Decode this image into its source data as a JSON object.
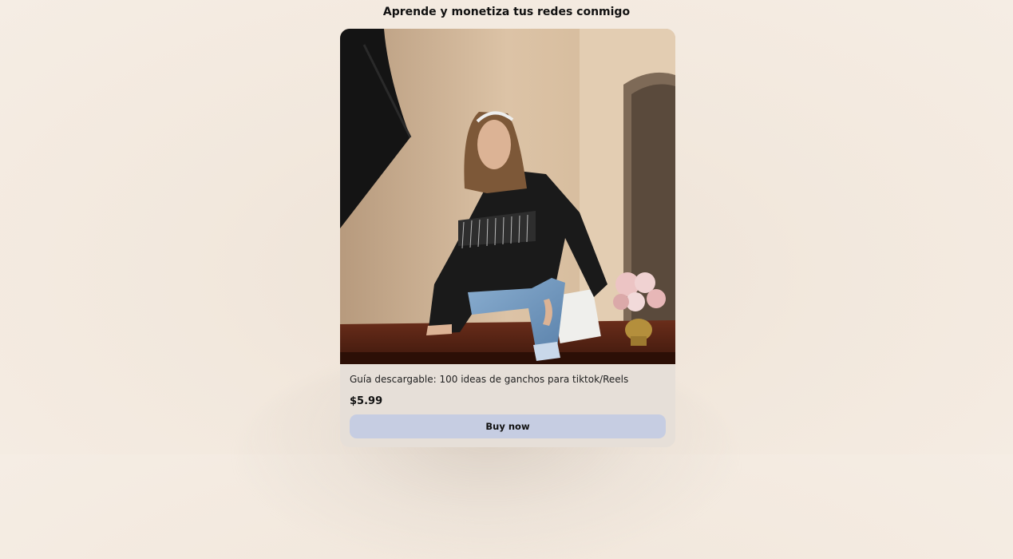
{
  "header": {
    "title": "Aprende y monetiza tus redes conmigo"
  },
  "product": {
    "title": "Guía descargable: 100 ideas de ganchos para tiktok/Reels",
    "price": "$5.99",
    "buy_label": "Buy now"
  },
  "colors": {
    "page_background": "#f2e8dd",
    "card_background": "#e6dfd8",
    "button_background": "#c6cde2",
    "text": "#111111"
  }
}
